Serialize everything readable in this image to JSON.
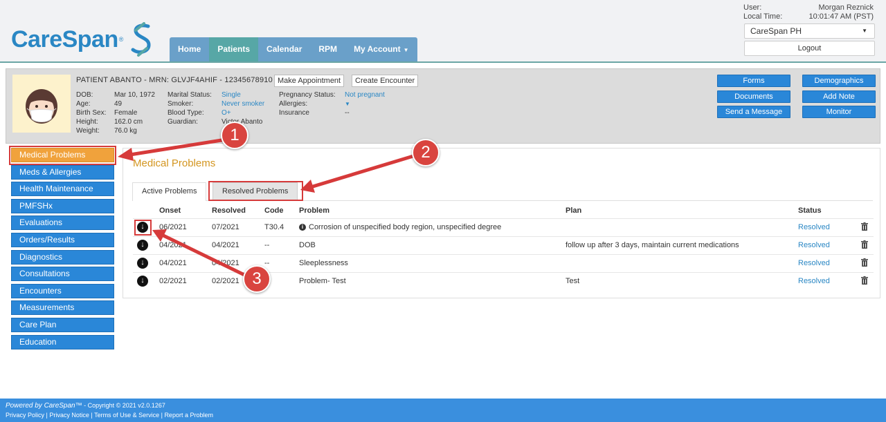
{
  "brand": {
    "name": "CareSpan",
    "reg": "®"
  },
  "nav": [
    {
      "label": "Home",
      "active": false
    },
    {
      "label": "Patients",
      "active": true
    },
    {
      "label": "Calendar",
      "active": false
    },
    {
      "label": "RPM",
      "active": false
    },
    {
      "label": "My Account",
      "active": false,
      "dropdown": true
    }
  ],
  "user": {
    "user_label": "User:",
    "user_name": "Morgan Reznick",
    "time_label": "Local Time:",
    "time_value": "10:01:47 AM (PST)",
    "org_select": "CareSpan PH",
    "logout": "Logout"
  },
  "patient": {
    "title": "PATIENT ABANTO - MRN: GLVJF4AHIF - 12345678910",
    "make_appointment": "Make Appointment",
    "create_encounter": "Create Encounter",
    "col1": [
      {
        "label": "DOB:",
        "value": "Mar 10, 1972"
      },
      {
        "label": "Age:",
        "value": "49"
      },
      {
        "label": "Birth Sex:",
        "value": "Female"
      },
      {
        "label": "Height:",
        "value": "162.0 cm"
      },
      {
        "label": "Weight:",
        "value": "76.0 kg"
      }
    ],
    "col2": [
      {
        "label": "Marital Status:",
        "value": "Single",
        "link": true
      },
      {
        "label": "Smoker:",
        "value": "Never smoker",
        "link": true
      },
      {
        "label": "Blood Type:",
        "value": "O+",
        "link": true
      },
      {
        "label": "Guardian:",
        "value": "Victor Abanto",
        "link": false
      }
    ],
    "col3": [
      {
        "label": "Pregnancy Status:",
        "value": "Not pregnant",
        "link": true
      },
      {
        "label": "Allergies:",
        "value": "▼",
        "link": true
      },
      {
        "label": "Insurance",
        "value": "--",
        "link": false
      }
    ],
    "buttons": {
      "forms": "Forms",
      "documents": "Documents",
      "send_message": "Send a Message",
      "demographics": "Demographics",
      "add_note": "Add Note",
      "monitor": "Monitor"
    }
  },
  "sidebar": [
    {
      "label": "Medical Problems",
      "active": true
    },
    {
      "label": "Meds & Allergies"
    },
    {
      "label": "Health Maintenance"
    },
    {
      "label": "PMFSHx"
    },
    {
      "label": "Evaluations"
    },
    {
      "label": "Orders/Results"
    },
    {
      "label": "Diagnostics"
    },
    {
      "label": "Consultations"
    },
    {
      "label": "Encounters"
    },
    {
      "label": "Measurements"
    },
    {
      "label": "Care Plan"
    },
    {
      "label": "Education"
    }
  ],
  "main": {
    "title": "Medical Problems",
    "tabs": {
      "active": "Active Problems",
      "resolved": "Resolved Problems"
    },
    "columns": {
      "onset": "Onset",
      "resolved": "Resolved",
      "code": "Code",
      "problem": "Problem",
      "plan": "Plan",
      "status": "Status"
    },
    "rows": [
      {
        "onset": "06/2021",
        "resolved": "07/2021",
        "code": "T30.4",
        "problem": "Corrosion of unspecified body region, unspecified degree",
        "info": true,
        "plan": "",
        "status": "Resolved"
      },
      {
        "onset": "04/2021",
        "resolved": "04/2021",
        "code": "--",
        "problem": "DOB",
        "info": false,
        "plan": "follow up after 3 days, maintain current medications",
        "status": "Resolved"
      },
      {
        "onset": "04/2021",
        "resolved": "04/2021",
        "code": "--",
        "problem": "Sleeplessness",
        "info": false,
        "plan": "",
        "status": "Resolved"
      },
      {
        "onset": "02/2021",
        "resolved": "02/2021",
        "code": "--",
        "problem": "Problem- Test",
        "info": false,
        "plan": "Test",
        "status": "Resolved"
      }
    ]
  },
  "annotations": {
    "badge1": "1",
    "badge2": "2",
    "badge3": "3"
  },
  "footer": {
    "powered": "Powered by CareSpan™",
    "copyright": " - Copyright © 2021 v2.0.1267",
    "links": [
      "Privacy Policy",
      "Privacy Notice",
      "Terms of Use & Service",
      "Report a Problem"
    ]
  },
  "colors": {
    "accent": "#2a87d8",
    "active_side": "#f0a23c",
    "title": "#d3951f",
    "annotation": "#d9443f",
    "teal": "#57a7a6"
  }
}
